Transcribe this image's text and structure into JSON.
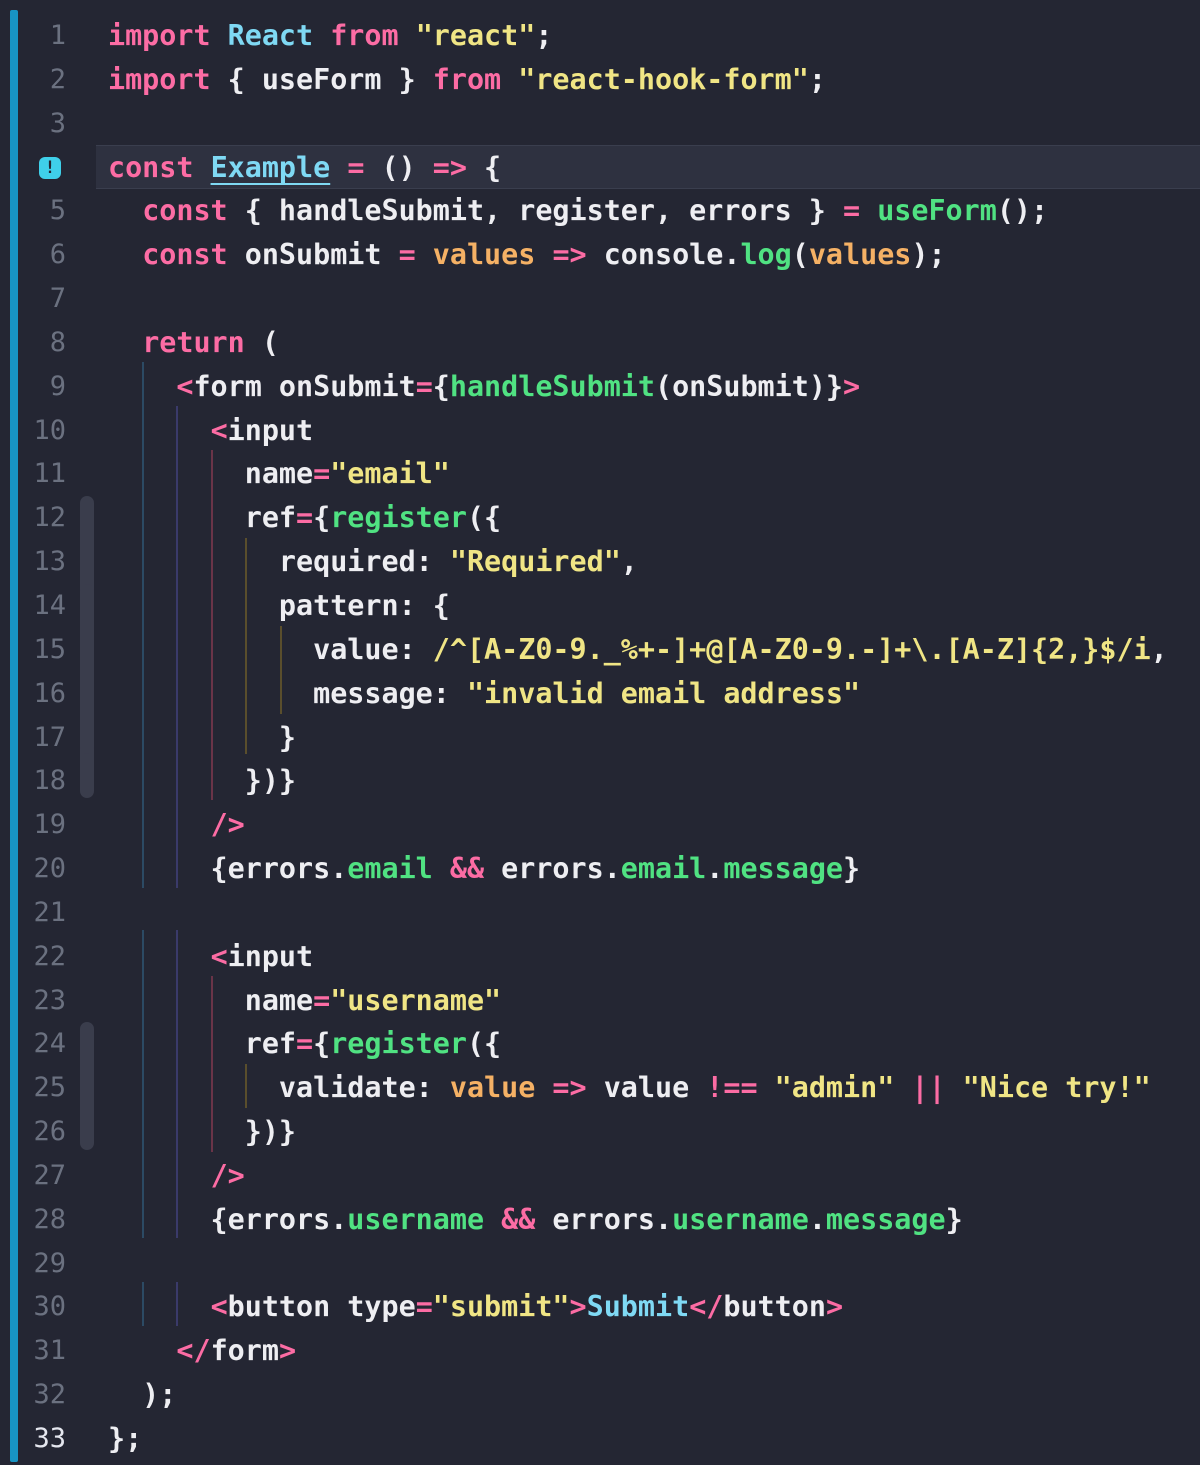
{
  "editor": {
    "active_line": 33,
    "lint_marker_line": 4,
    "lint_marker_symbol": "!",
    "colors": {
      "background": "#242633",
      "vcs_bar": "#1894c3",
      "keyword": "#fc6ca4",
      "string": "#f0e585",
      "function": "#50e282",
      "parameter": "#f5b165",
      "class": "#7fd9f4"
    }
  },
  "line_numbers": [
    "1",
    "2",
    "3",
    "4",
    "5",
    "6",
    "7",
    "8",
    "9",
    "10",
    "11",
    "12",
    "13",
    "14",
    "15",
    "16",
    "17",
    "18",
    "19",
    "20",
    "21",
    "22",
    "23",
    "24",
    "25",
    "26",
    "27",
    "28",
    "29",
    "30",
    "31",
    "32",
    "33"
  ],
  "code_lines": [
    [
      [
        "kw",
        "import"
      ],
      [
        "p",
        " "
      ],
      [
        "cls",
        "React"
      ],
      [
        "p",
        " "
      ],
      [
        "kw",
        "from"
      ],
      [
        "p",
        " "
      ],
      [
        "str",
        "\"react\""
      ],
      [
        "p",
        ";"
      ]
    ],
    [
      [
        "kw",
        "import"
      ],
      [
        "p",
        " { useForm } "
      ],
      [
        "kw",
        "from"
      ],
      [
        "p",
        " "
      ],
      [
        "str",
        "\"react-hook-form\""
      ],
      [
        "p",
        ";"
      ]
    ],
    [],
    [
      [
        "kw",
        "const"
      ],
      [
        "p",
        " "
      ],
      [
        "ul",
        "Example"
      ],
      [
        "p",
        " "
      ],
      [
        "op",
        "="
      ],
      [
        "p",
        " () "
      ],
      [
        "op",
        "=>"
      ],
      [
        "p",
        " {"
      ]
    ],
    [
      [
        "p",
        "  "
      ],
      [
        "kw",
        "const"
      ],
      [
        "p",
        " { handleSubmit, register, errors } "
      ],
      [
        "op",
        "="
      ],
      [
        "p",
        " "
      ],
      [
        "fn",
        "useForm"
      ],
      [
        "p",
        "();"
      ]
    ],
    [
      [
        "p",
        "  "
      ],
      [
        "kw",
        "const"
      ],
      [
        "p",
        " onSubmit "
      ],
      [
        "op",
        "="
      ],
      [
        "p",
        " "
      ],
      [
        "param",
        "values"
      ],
      [
        "p",
        " "
      ],
      [
        "op",
        "=>"
      ],
      [
        "p",
        " console."
      ],
      [
        "fn",
        "log"
      ],
      [
        "p",
        "("
      ],
      [
        "param",
        "values"
      ],
      [
        "p",
        ");"
      ]
    ],
    [],
    [
      [
        "p",
        "  "
      ],
      [
        "kw",
        "return"
      ],
      [
        "p",
        " ("
      ]
    ],
    [
      [
        "p",
        "    "
      ],
      [
        "tag",
        "<"
      ],
      [
        "p",
        "form onSubmit"
      ],
      [
        "op",
        "="
      ],
      [
        "p",
        "{"
      ],
      [
        "fn",
        "handleSubmit"
      ],
      [
        "p",
        "(onSubmit)}"
      ],
      [
        "tag",
        ">"
      ]
    ],
    [
      [
        "p",
        "      "
      ],
      [
        "tag",
        "<"
      ],
      [
        "p",
        "input"
      ]
    ],
    [
      [
        "p",
        "        name"
      ],
      [
        "op",
        "="
      ],
      [
        "str",
        "\"email\""
      ]
    ],
    [
      [
        "p",
        "        ref"
      ],
      [
        "op",
        "="
      ],
      [
        "p",
        "{"
      ],
      [
        "fn",
        "register"
      ],
      [
        "p",
        "({"
      ]
    ],
    [
      [
        "p",
        "          required: "
      ],
      [
        "str",
        "\"Required\""
      ],
      [
        "p",
        ","
      ]
    ],
    [
      [
        "p",
        "          pattern: {"
      ]
    ],
    [
      [
        "p",
        "            value: "
      ],
      [
        "str",
        "/^[A-Z0-9._%+-]+@[A-Z0-9.-]+\\.[A-Z]{2,}$/i"
      ],
      [
        "p",
        ","
      ]
    ],
    [
      [
        "p",
        "            message: "
      ],
      [
        "str",
        "\"invalid email address\""
      ]
    ],
    [
      [
        "p",
        "          }"
      ]
    ],
    [
      [
        "p",
        "        })}"
      ]
    ],
    [
      [
        "p",
        "      "
      ],
      [
        "tag",
        "/>"
      ]
    ],
    [
      [
        "p",
        "      {errors."
      ],
      [
        "fn",
        "email"
      ],
      [
        "p",
        " "
      ],
      [
        "op",
        "&&"
      ],
      [
        "p",
        " errors."
      ],
      [
        "fn",
        "email"
      ],
      [
        "p",
        "."
      ],
      [
        "fn",
        "message"
      ],
      [
        "p",
        "}"
      ]
    ],
    [],
    [
      [
        "p",
        "      "
      ],
      [
        "tag",
        "<"
      ],
      [
        "p",
        "input"
      ]
    ],
    [
      [
        "p",
        "        name"
      ],
      [
        "op",
        "="
      ],
      [
        "str",
        "\"username\""
      ]
    ],
    [
      [
        "p",
        "        ref"
      ],
      [
        "op",
        "="
      ],
      [
        "p",
        "{"
      ],
      [
        "fn",
        "register"
      ],
      [
        "p",
        "({"
      ]
    ],
    [
      [
        "p",
        "          validate: "
      ],
      [
        "param",
        "value"
      ],
      [
        "p",
        " "
      ],
      [
        "op",
        "=>"
      ],
      [
        "p",
        " value "
      ],
      [
        "op",
        "!=="
      ],
      [
        "p",
        " "
      ],
      [
        "str",
        "\"admin\""
      ],
      [
        "p",
        " "
      ],
      [
        "op",
        "||"
      ],
      [
        "p",
        " "
      ],
      [
        "str",
        "\"Nice try!\""
      ]
    ],
    [
      [
        "p",
        "        })}"
      ]
    ],
    [
      [
        "p",
        "      "
      ],
      [
        "tag",
        "/>"
      ]
    ],
    [
      [
        "p",
        "      {errors."
      ],
      [
        "fn",
        "username"
      ],
      [
        "p",
        " "
      ],
      [
        "op",
        "&&"
      ],
      [
        "p",
        " errors."
      ],
      [
        "fn",
        "username"
      ],
      [
        "p",
        "."
      ],
      [
        "fn",
        "message"
      ],
      [
        "p",
        "}"
      ]
    ],
    [],
    [
      [
        "p",
        "      "
      ],
      [
        "tag",
        "<"
      ],
      [
        "p",
        "button type"
      ],
      [
        "op",
        "="
      ],
      [
        "str",
        "\"submit\""
      ],
      [
        "tag",
        ">"
      ],
      [
        "cls",
        "Submit"
      ],
      [
        "tag",
        "</"
      ],
      [
        "p",
        "button"
      ],
      [
        "tag",
        ">"
      ]
    ],
    [
      [
        "p",
        "    "
      ],
      [
        "tag",
        "</"
      ],
      [
        "p",
        "form"
      ],
      [
        "tag",
        ">"
      ]
    ],
    [
      [
        "p",
        "  );"
      ]
    ],
    [
      [
        "p",
        "};"
      ]
    ]
  ]
}
